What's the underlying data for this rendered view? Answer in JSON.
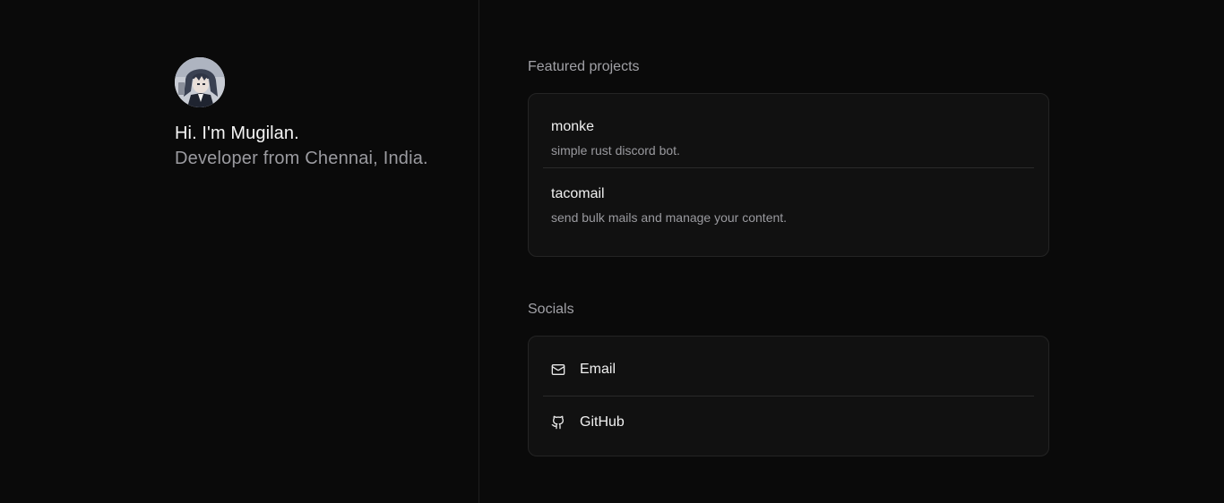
{
  "intro": {
    "greeting": "Hi. I'm Mugilan.",
    "tagline": "Developer from Chennai, India."
  },
  "projects": {
    "title": "Featured projects",
    "items": [
      {
        "name": "monke",
        "description": "simple rust discord bot."
      },
      {
        "name": "tacomail",
        "description": "send bulk mails and manage your content."
      }
    ]
  },
  "socials": {
    "title": "Socials",
    "items": [
      {
        "label": "Email",
        "icon": "mail-icon"
      },
      {
        "label": "GitHub",
        "icon": "github-icon"
      }
    ]
  },
  "colors": {
    "background": "#0a0a0a",
    "card": "#111111",
    "border": "#242424",
    "muted_text": "#9b9ba0"
  }
}
